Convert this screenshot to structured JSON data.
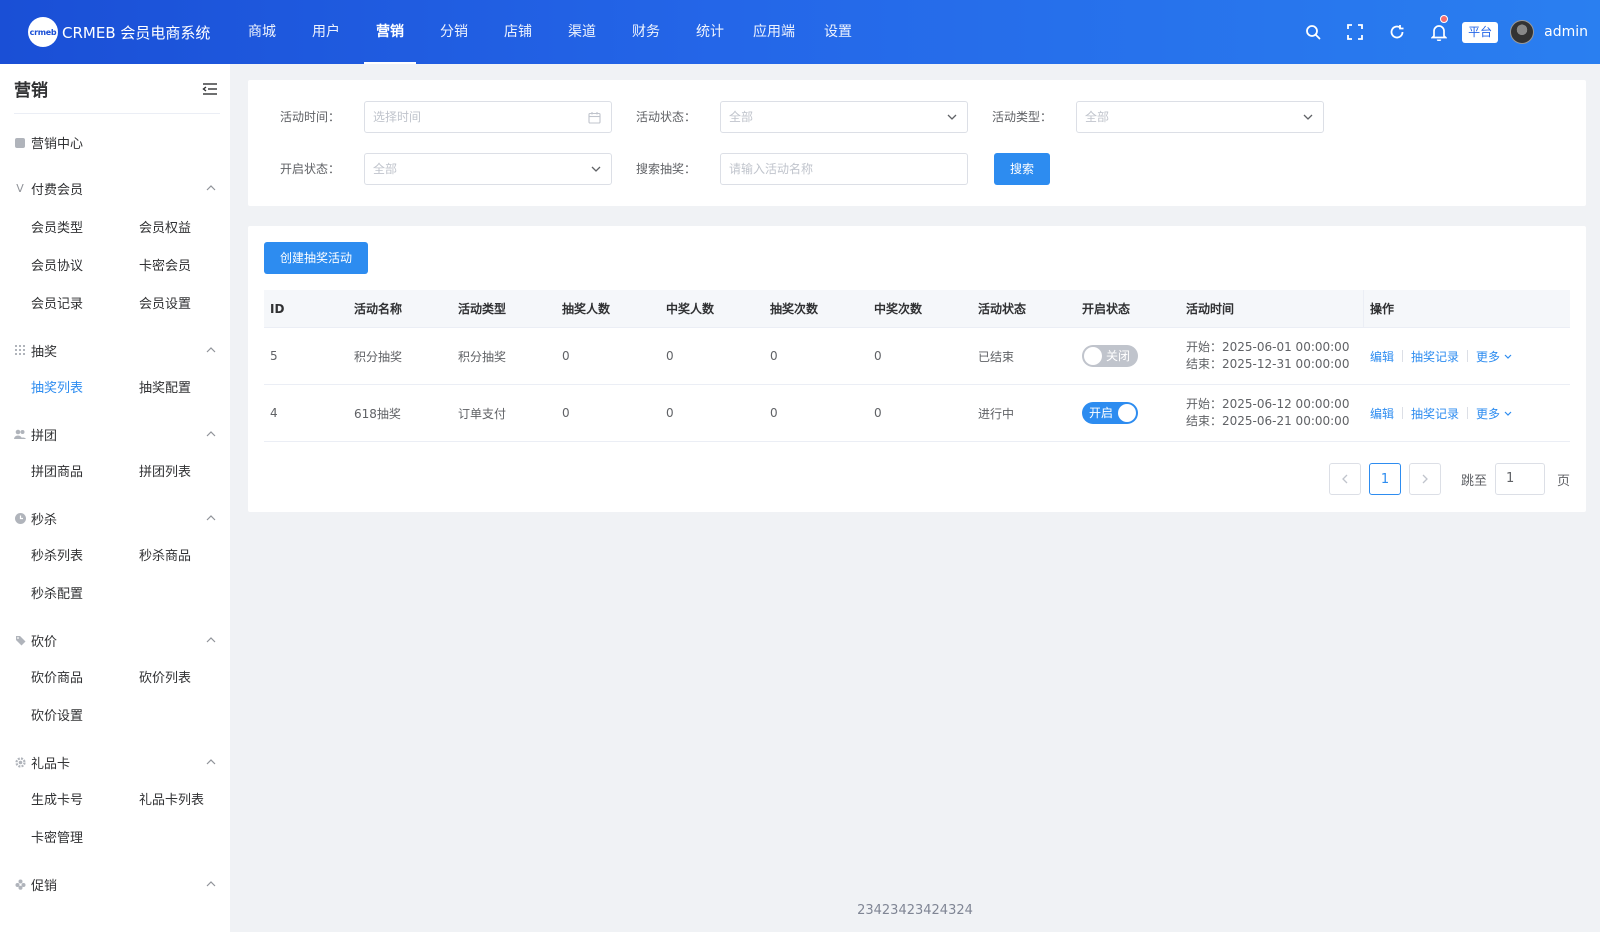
{
  "brand": {
    "logo_text": "crmeb",
    "name": "CRMEB 会员电商系统"
  },
  "topnav": [
    "商城",
    "用户",
    "营销",
    "分销",
    "店铺",
    "渠道",
    "财务",
    "统计",
    "应用端",
    "设置"
  ],
  "header": {
    "platform_label": "平台",
    "username": "admin"
  },
  "sidebar": {
    "title": "营销",
    "center": "营销中心",
    "groups": [
      {
        "label": "付费会员",
        "items": [
          "会员类型",
          "会员权益",
          "会员协议",
          "卡密会员",
          "会员记录",
          "会员设置"
        ]
      },
      {
        "label": "抽奖",
        "items": [
          "抽奖列表",
          "抽奖配置"
        ]
      },
      {
        "label": "拼团",
        "items": [
          "拼团商品",
          "拼团列表"
        ]
      },
      {
        "label": "秒杀",
        "items": [
          "秒杀列表",
          "秒杀商品",
          "秒杀配置"
        ]
      },
      {
        "label": "砍价",
        "items": [
          "砍价商品",
          "砍价列表",
          "砍价设置"
        ]
      },
      {
        "label": "礼品卡",
        "items": [
          "生成卡号",
          "礼品卡列表",
          "卡密管理"
        ]
      },
      {
        "label": "促销",
        "items": []
      }
    ]
  },
  "filters": {
    "time_label": "活动时间：",
    "time_placeholder": "选择时间",
    "status_label": "活动状态：",
    "status_value": "全部",
    "type_label": "活动类型：",
    "type_value": "全部",
    "open_label": "开启状态：",
    "open_value": "全部",
    "search_label": "搜索抽奖：",
    "search_placeholder": "请输入活动名称",
    "search_button": "搜索"
  },
  "create_button": "创建抽奖活动",
  "table": {
    "headers": [
      "ID",
      "活动名称",
      "活动类型",
      "抽奖人数",
      "中奖人数",
      "抽奖次数",
      "中奖次数",
      "活动状态",
      "开启状态",
      "活动时间",
      "操作"
    ],
    "rows": [
      {
        "id": "5",
        "name": "积分抽奖",
        "type": "积分抽奖",
        "draw_users": "0",
        "win_users": "0",
        "draw_times": "0",
        "win_times": "0",
        "status": "已结束",
        "switch_on": false,
        "switch_text": "关闭",
        "start": "开始：2025-06-01 00:00:00",
        "end": "结束：2025-12-31 00:00:00"
      },
      {
        "id": "4",
        "name": "618抽奖",
        "type": "订单支付",
        "draw_users": "0",
        "win_users": "0",
        "draw_times": "0",
        "win_times": "0",
        "status": "进行中",
        "switch_on": true,
        "switch_text": "开启",
        "start": "开始：2025-06-12 00:00:00",
        "end": "结束：2025-06-21 00:00:00"
      }
    ],
    "ops": {
      "edit": "编辑",
      "records": "抽奖记录",
      "more": "更多"
    }
  },
  "pagination": {
    "current": "1",
    "jump_label": "跳至",
    "jump_value": "1",
    "page_suffix": "页"
  },
  "footer": "23423423424324",
  "colors": {
    "primary": "#2d8cf0",
    "header_gradient_start": "#1a4fd6",
    "header_gradient_end": "#2a7ff0",
    "badge_red": "#f56c6c"
  }
}
